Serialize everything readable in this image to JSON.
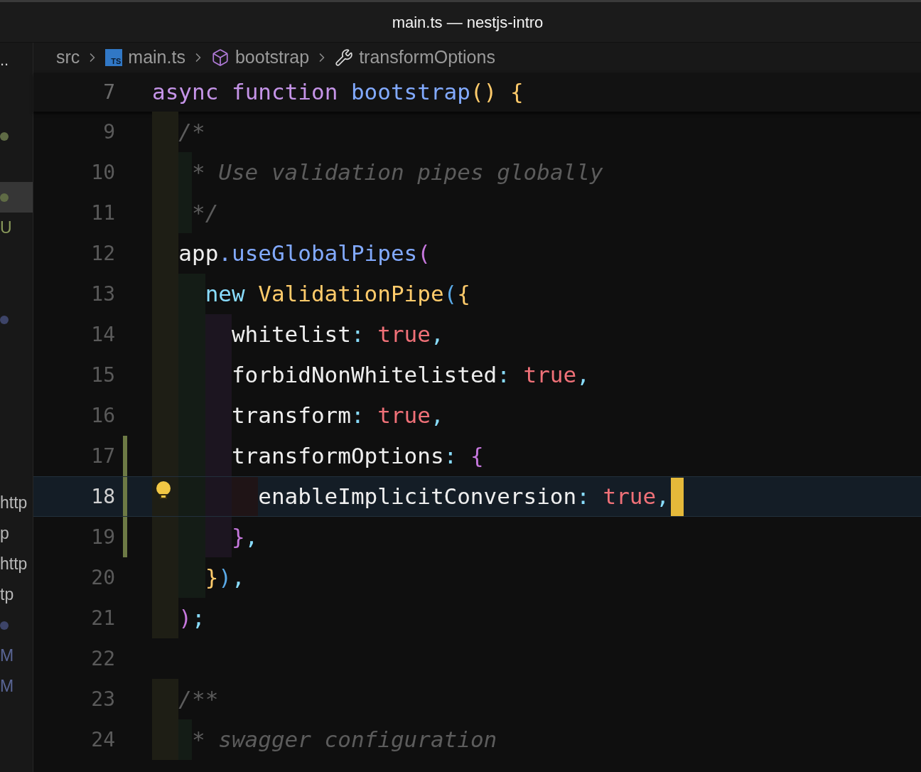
{
  "window": {
    "title": "main.ts — nestjs-intro"
  },
  "sidebar": {
    "header": "..",
    "items": [
      {
        "kind": "dot",
        "color": "#5f6b45",
        "selected": false
      },
      {
        "kind": "spacer",
        "selected": false
      },
      {
        "kind": "dot",
        "color": "#5f6b45",
        "selected": true
      },
      {
        "kind": "text",
        "text": "U",
        "color": "#8a9a5b",
        "selected": false
      },
      {
        "kind": "spacer",
        "selected": false
      },
      {
        "kind": "spacer",
        "selected": false
      },
      {
        "kind": "dot",
        "color": "#3d4468",
        "selected": false
      },
      {
        "kind": "spacer",
        "selected": false
      },
      {
        "kind": "spacer",
        "selected": false
      },
      {
        "kind": "spacer",
        "selected": false
      },
      {
        "kind": "spacer",
        "selected": false
      },
      {
        "kind": "spacer",
        "selected": false
      },
      {
        "kind": "text",
        "text": "http",
        "color": "#b8b8b8",
        "selected": false
      },
      {
        "kind": "text",
        "text": "p",
        "color": "#b8b8b8",
        "selected": false
      },
      {
        "kind": "text",
        "text": "http",
        "color": "#b8b8b8",
        "selected": false
      },
      {
        "kind": "text",
        "text": "tp",
        "color": "#b8b8b8",
        "selected": false
      },
      {
        "kind": "dot",
        "color": "#3d4468",
        "selected": false
      },
      {
        "kind": "text",
        "text": "M",
        "color": "#5a6696",
        "selected": false
      },
      {
        "kind": "text",
        "text": "M",
        "color": "#5a6696",
        "selected": false
      }
    ]
  },
  "breadcrumbs": [
    {
      "kind": "folder",
      "label": "src"
    },
    {
      "kind": "file",
      "label": "main.ts",
      "badge": "TS"
    },
    {
      "kind": "module",
      "label": "bootstrap"
    },
    {
      "kind": "method",
      "label": "transformOptions"
    }
  ],
  "editor": {
    "sticky_line": {
      "number": "7",
      "tokens": [
        {
          "kind": "keyword",
          "text": "async"
        },
        {
          "kind": "keyword",
          "text": "function"
        },
        {
          "kind": "fn",
          "text": "bootstrap"
        },
        {
          "kind": "yellow",
          "text": "() {"
        }
      ],
      "children": [
        {
          "number": "9",
          "modified": false,
          "selected": false,
          "tokens": [
            {
              "kind": "comment",
              "text": "/*"
            }
          ],
          "children": [
            {
              "number": "10",
              "modified": false,
              "selected": false,
              "tokens": [
                {
                  "kind": "comment",
                  "text": "* Use validation pipes globally"
                }
              ]
            },
            {
              "number": "11",
              "modified": false,
              "selected": false,
              "tokens": [
                {
                  "kind": "comment",
                  "text": "*/"
                }
              ]
            }
          ]
        },
        {
          "number": "12",
          "modified": false,
          "selected": false,
          "tokens": [
            {
              "kind": "plain",
              "text": "app"
            },
            {
              "kind": "method",
              "text": ".useGlobalPipes"
            },
            {
              "kind": "pink",
              "text": "("
            }
          ],
          "children": [
            {
              "number": "13",
              "modified": false,
              "selected": false,
              "tokens": [
                {
                  "kind": "new",
                  "text": "new"
                },
                {
                  "kind": "class",
                  "text": "ValidationPipe"
                },
                {
                  "kind": "blue",
                  "text": "("
                },
                {
                  "kind": "yellow",
                  "text": "{"
                }
              ],
              "children": [
                {
                  "number": "14",
                  "modified": false,
                  "selected": false,
                  "tokens": [
                    {
                      "kind": "plain",
                      "text": "whitelist"
                    },
                    {
                      "kind": "punct",
                      "text": ":"
                    },
                    {
                      "kind": "bool",
                      "text": "true"
                    },
                    {
                      "kind": "punct",
                      "text": ","
                    }
                  ]
                },
                {
                  "number": "15",
                  "modified": false,
                  "selected": false,
                  "tokens": [
                    {
                      "kind": "plain",
                      "text": "forbidNonWhitelisted"
                    },
                    {
                      "kind": "punct",
                      "text": ":"
                    },
                    {
                      "kind": "bool",
                      "text": "true"
                    },
                    {
                      "kind": "punct",
                      "text": ","
                    }
                  ]
                },
                {
                  "number": "16",
                  "modified": false,
                  "selected": false,
                  "tokens": [
                    {
                      "kind": "plain",
                      "text": "transform"
                    },
                    {
                      "kind": "punct",
                      "text": ":"
                    },
                    {
                      "kind": "bool",
                      "text": "true"
                    },
                    {
                      "kind": "punct",
                      "text": ","
                    }
                  ]
                },
                {
                  "number": "17",
                  "modified": true,
                  "selected": false,
                  "tokens": [
                    {
                      "kind": "plain",
                      "text": "transformOptions"
                    },
                    {
                      "kind": "punct",
                      "text": ":"
                    },
                    {
                      "kind": "pink",
                      "text": "{"
                    }
                  ],
                  "children": [
                    {
                      "number": "18",
                      "modified": true,
                      "selected": true,
                      "tokens": [
                        {
                          "kind": "plain",
                          "text": "enableImplicitConversion"
                        },
                        {
                          "kind": "punct",
                          "text": ":"
                        },
                        {
                          "kind": "bool",
                          "text": "true"
                        },
                        {
                          "kind": "punct",
                          "text": ","
                        }
                      ]
                    }
                  ]
                },
                {
                  "number": "19",
                  "modified": true,
                  "selected": false,
                  "tokens": [
                    {
                      "kind": "pink",
                      "text": "}"
                    },
                    {
                      "kind": "punct",
                      "text": ","
                    }
                  ]
                }
              ]
            },
            {
              "number": "20",
              "modified": false,
              "selected": false,
              "tokens": [
                {
                  "kind": "yellow",
                  "text": "}"
                },
                {
                  "kind": "blue",
                  "text": ")"
                },
                {
                  "kind": "punct",
                  "text": ","
                }
              ]
            }
          ]
        },
        {
          "number": "21",
          "modified": false,
          "selected": false,
          "tokens": [
            {
              "kind": "pink",
              "text": ")"
            },
            {
              "kind": "punct",
              "text": ";"
            }
          ]
        },
        {
          "number": "22",
          "modified": false,
          "selected": false
        },
        {
          "number": "23",
          "modified": false,
          "selected": false,
          "tokens": [
            {
              "kind": "comment",
              "text": "/**"
            }
          ],
          "children": [
            {
              "number": "24",
              "modified": false,
              "selected": false,
              "tokens": [
                {
                  "kind": "comment",
                  "text": "* swagger configuration"
                }
              ]
            }
          ]
        }
      ]
    }
  }
}
